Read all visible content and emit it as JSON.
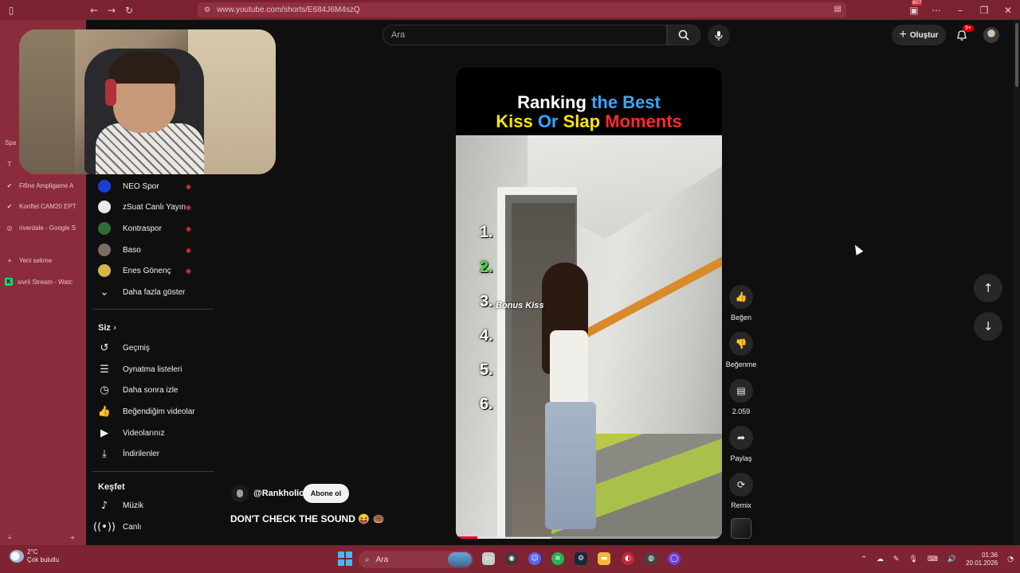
{
  "browser": {
    "url": "www.youtube.com/shorts/E684J6M4szQ",
    "profile_badge": "807"
  },
  "tabs": {
    "partial_label": "Spa",
    "letter_tab": "T",
    "items": [
      {
        "label": "Fifine Ampligame A",
        "icon": "check-icon"
      },
      {
        "label": "Konftel CAM20 EPT",
        "icon": "check-icon"
      },
      {
        "label": "riverdale - Google S",
        "icon": "google-icon"
      }
    ],
    "new_tab": "Yeni sekme",
    "stream_tab": "sivrii Stream - Watc"
  },
  "youtube": {
    "search_placeholder": "Ara",
    "create_label": "Oluştur",
    "notif_badge": "9+"
  },
  "guide": {
    "subscriptions": [
      {
        "name": "NEO Spor",
        "color": "#1a3fd8"
      },
      {
        "name": "zSuat Canlı Yayın",
        "color": "#e9e9e9"
      },
      {
        "name": "Kontraspor",
        "color": "#2f6b3a"
      },
      {
        "name": "Baso",
        "color": "#7a6e62"
      },
      {
        "name": "Enes Gönenç",
        "color": "#d6b44a"
      }
    ],
    "show_more": "Daha fazla göster",
    "you_section": "Siz",
    "you_items": [
      "Geçmiş",
      "Oynatma listeleri",
      "Daha sonra izle",
      "Beğendiğim videolar",
      "Videolarınız",
      "İndirilenler"
    ],
    "explore_section": "Keşfet",
    "explore_items": [
      "Müzik",
      "Canlı"
    ]
  },
  "short": {
    "title_line1_a": "Ranking",
    "title_line1_b": "the Best",
    "title_line2_a": "Kiss",
    "title_line2_b": "Or",
    "title_line2_c": "Slap",
    "title_line2_d": "Moments",
    "ranks": [
      "1.",
      "2.",
      "3.",
      "4.",
      "5.",
      "6."
    ],
    "bonus": "Bonus Kiss",
    "progress": 0.08,
    "channel": "@Rankholic",
    "subscribe": "Abone ol",
    "caption": "DON'T CHECK THE SOUND 😝 🍩"
  },
  "actions": {
    "like": "Beğen",
    "dislike": "Beğenme",
    "comments": "2.059",
    "share": "Paylaş",
    "remix": "Remix"
  },
  "taskbar": {
    "temp": "2°C",
    "weather": "Çok bulutlu",
    "search": "Ara",
    "time": "01:36",
    "date": "20.01.2026"
  }
}
